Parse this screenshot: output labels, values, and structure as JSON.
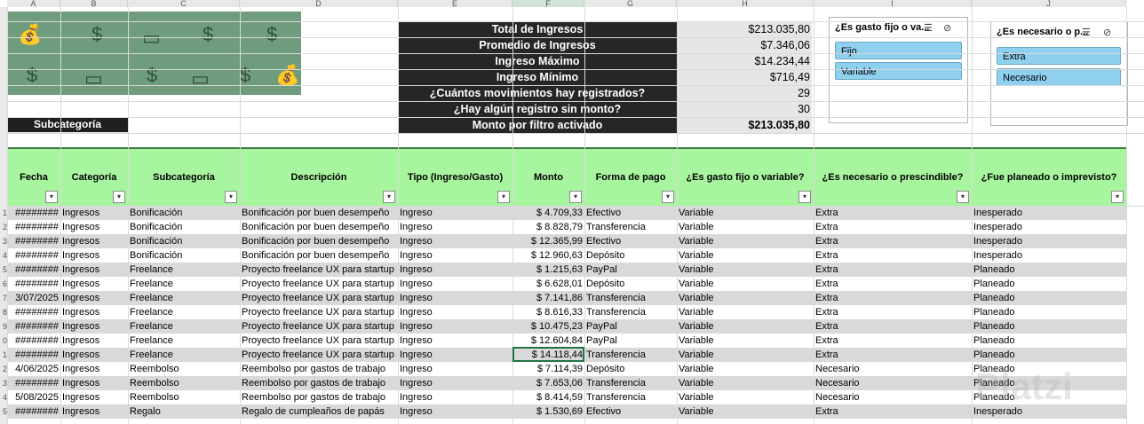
{
  "columns": [
    "A",
    "B",
    "C",
    "D",
    "E",
    "F",
    "G",
    "H",
    "I",
    "J"
  ],
  "summary": {
    "labels": [
      "Total de Ingresos",
      "Promedio de Ingresos",
      "Ingreso Máximo",
      "Ingreso Mínimo",
      "¿Cuántos movimientos hay registrados?",
      "¿Hay algún registro sin monto?",
      "Monto por filtro activado"
    ],
    "values": [
      "$213.035,80",
      "$7.346,06",
      "$14.234,44",
      "$716,49",
      "29",
      "30",
      "$213.035,80"
    ]
  },
  "subcategoria_label": "Subcategoría",
  "slicers": [
    {
      "title": "¿Es gasto fijo o va...",
      "items": [
        "Fijo",
        "Variable"
      ]
    },
    {
      "title": "¿Es necesario o p...",
      "items": [
        "Extra",
        "Necesario"
      ]
    }
  ],
  "table": {
    "headers": [
      "Fecha",
      "Categoría",
      "Subcategoría",
      "Descripción",
      "Tipo (Ingreso/Gasto)",
      "Monto",
      "Forma de pago",
      "¿Es gasto fijo o variable?",
      "¿Es necesario o prescindible?",
      "¿Fue planeado o imprevisto?"
    ],
    "rows": [
      [
        "########",
        "Ingresos",
        "Bonificación",
        "Bonificación por buen desempeño",
        "Ingreso",
        "$ 4.709,33",
        "Efectivo",
        "Variable",
        "Extra",
        "Inesperado"
      ],
      [
        "########",
        "Ingresos",
        "Bonificación",
        "Bonificación por buen desempeño",
        "Ingreso",
        "$ 8.828,79",
        "Transferencia",
        "Variable",
        "Extra",
        "Inesperado"
      ],
      [
        "########",
        "Ingresos",
        "Bonificación",
        "Bonificación por buen desempeño",
        "Ingreso",
        "$ 12.365,99",
        "Efectivo",
        "Variable",
        "Extra",
        "Inesperado"
      ],
      [
        "########",
        "Ingresos",
        "Bonificación",
        "Bonificación por buen desempeño",
        "Ingreso",
        "$ 12.960,63",
        "Depósito",
        "Variable",
        "Extra",
        "Inesperado"
      ],
      [
        "########",
        "Ingresos",
        "Freelance",
        "Proyecto freelance UX para startup",
        "Ingreso",
        "$ 1.215,63",
        "PayPal",
        "Variable",
        "Extra",
        "Planeado"
      ],
      [
        "########",
        "Ingresos",
        "Freelance",
        "Proyecto freelance UX para startup",
        "Ingreso",
        "$ 6.628,01",
        "Depósito",
        "Variable",
        "Extra",
        "Planeado"
      ],
      [
        "3/07/2025",
        "Ingresos",
        "Freelance",
        "Proyecto freelance UX para startup",
        "Ingreso",
        "$ 7.141,86",
        "Transferencia",
        "Variable",
        "Extra",
        "Planeado"
      ],
      [
        "########",
        "Ingresos",
        "Freelance",
        "Proyecto freelance UX para startup",
        "Ingreso",
        "$ 8.616,33",
        "Transferencia",
        "Variable",
        "Extra",
        "Planeado"
      ],
      [
        "########",
        "Ingresos",
        "Freelance",
        "Proyecto freelance UX para startup",
        "Ingreso",
        "$ 10.475,23",
        "PayPal",
        "Variable",
        "Extra",
        "Planeado"
      ],
      [
        "########",
        "Ingresos",
        "Freelance",
        "Proyecto freelance UX para startup",
        "Ingreso",
        "$ 12.604,84",
        "PayPal",
        "Variable",
        "Extra",
        "Planeado"
      ],
      [
        "########",
        "Ingresos",
        "Freelance",
        "Proyecto freelance UX para startup",
        "Ingreso",
        "$ 14.118,44",
        "Transferencia",
        "Variable",
        "Extra",
        "Planeado"
      ],
      [
        "4/06/2025",
        "Ingresos",
        "Reembolso",
        "Reembolso por gastos de trabajo",
        "Ingreso",
        "$ 7.114,39",
        "Depósito",
        "Variable",
        "Necesario",
        "Planeado"
      ],
      [
        "########",
        "Ingresos",
        "Reembolso",
        "Reembolso por gastos de trabajo",
        "Ingreso",
        "$ 7.653,06",
        "Transferencia",
        "Variable",
        "Necesario",
        "Planeado"
      ],
      [
        "5/08/2025",
        "Ingresos",
        "Reembolso",
        "Reembolso por gastos de trabajo",
        "Ingreso",
        "$ 8.414,59",
        "Transferencia",
        "Variable",
        "Necesario",
        "Planeado"
      ],
      [
        "########",
        "Ingresos",
        "Regalo",
        "Regalo de cumpleaños de papás",
        "Ingreso",
        "$ 1.530,69",
        "Efectivo",
        "Variable",
        "Extra",
        "Inesperado"
      ]
    ]
  },
  "row_numbers": [
    "1",
    "2",
    "3",
    "4",
    "5",
    "6",
    "7",
    "8",
    "9",
    "0",
    "1",
    "2",
    "3",
    "4",
    "5"
  ],
  "watermark": "Platzi"
}
